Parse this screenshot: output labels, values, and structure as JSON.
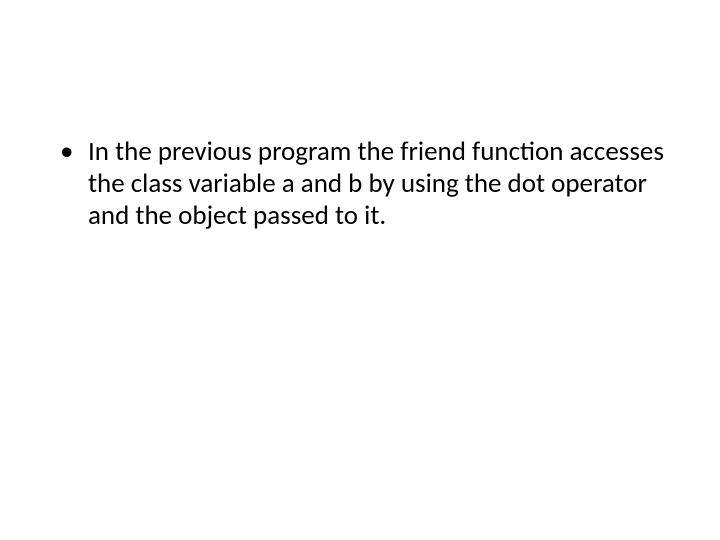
{
  "slide": {
    "bullets": [
      "In the previous program the friend function accesses the class variable a and b by using the dot operator and the object passed to it."
    ]
  }
}
